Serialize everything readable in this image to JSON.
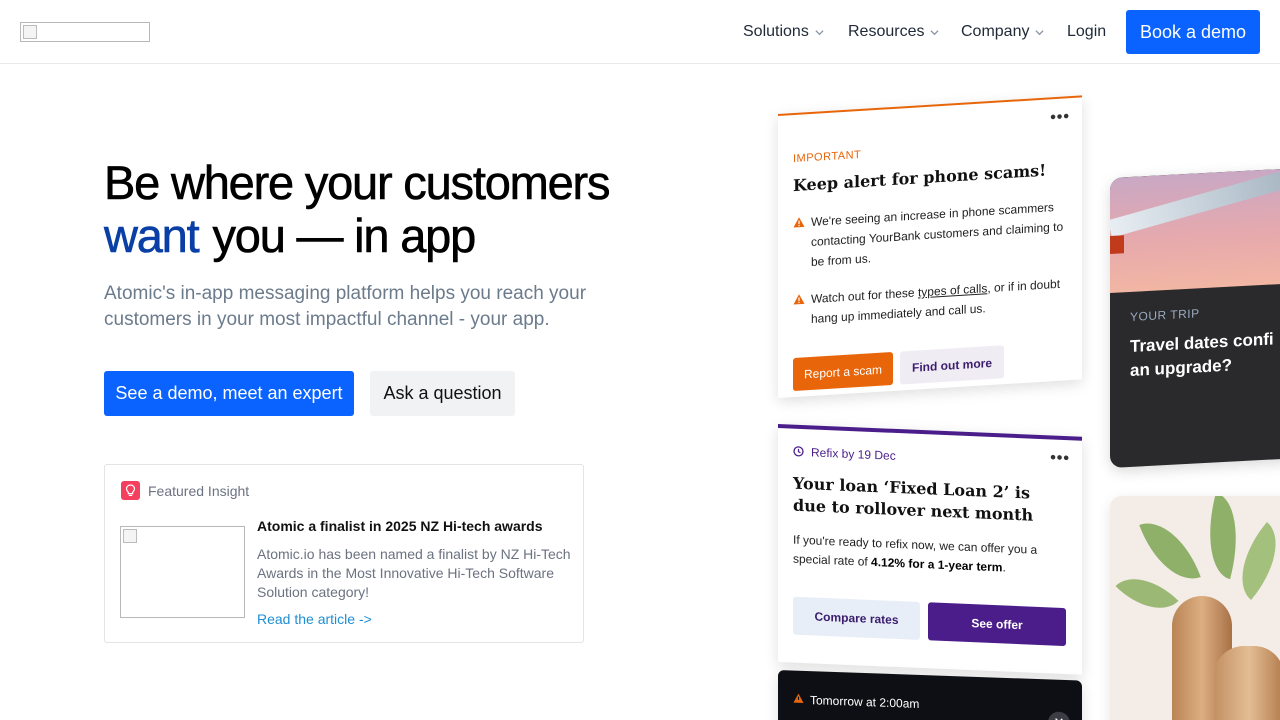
{
  "header": {
    "nav": [
      {
        "label": "Solutions"
      },
      {
        "label": "Resources"
      },
      {
        "label": "Company"
      }
    ],
    "login_label": "Login",
    "cta_label": "Book a demo"
  },
  "hero": {
    "headline_line1": "Be where your customers",
    "headline_accent": "want",
    "headline_rest": "you — in app",
    "subhead": "Atomic's in-app messaging platform helps you reach your customers in your most impactful channel - your app.",
    "primary_cta": "See a demo, meet an expert",
    "secondary_cta": "Ask a question"
  },
  "insight": {
    "tag": "Featured Insight",
    "title": "Atomic a finalist in 2025 NZ Hi-tech awards",
    "description": "Atomic.io has been named a finalist by NZ Hi-Tech Awards in the Most Innovative Hi-Tech Software Solution category!",
    "link": "Read the article ->"
  },
  "cards": {
    "scam": {
      "label": "IMPORTANT",
      "title": "Keep alert for phone scams!",
      "row1": "We're seeing an increase in phone scammers contacting YourBank customers and claiming to be from us.",
      "row2_pre": "Watch out for these ",
      "row2_link": "types of calls",
      "row2_post": ", or if in doubt hang up immediately and call us.",
      "btn_primary": "Report a scam",
      "btn_secondary": "Find out more",
      "menu": "•••"
    },
    "loan": {
      "label": "Refix by 19 Dec",
      "title": "Your loan ‘Fixed Loan 2’ is due to rollover next month",
      "body_pre": "If you're ready to refix now, we can offer you a special rate of ",
      "body_bold": "4.12% for a 1-year term",
      "body_post": ".",
      "btn_secondary": "Compare rates",
      "btn_primary": "See offer",
      "menu": "•••"
    },
    "alert": {
      "text": "Tomorrow at 2:00am",
      "close": "✕"
    },
    "trip": {
      "label": "YOUR TRIP",
      "title_line1": "Travel dates confi",
      "title_line2": "an upgrade?"
    }
  },
  "colors": {
    "primary_blue": "#0a63ff",
    "accent_blue": "#0a3fa6",
    "orange": "#e8650a",
    "purple": "#4a1d8a"
  },
  "icons": [
    "chevron-down-icon",
    "lightbulb-icon",
    "warning-icon",
    "clock-icon",
    "close-icon"
  ]
}
